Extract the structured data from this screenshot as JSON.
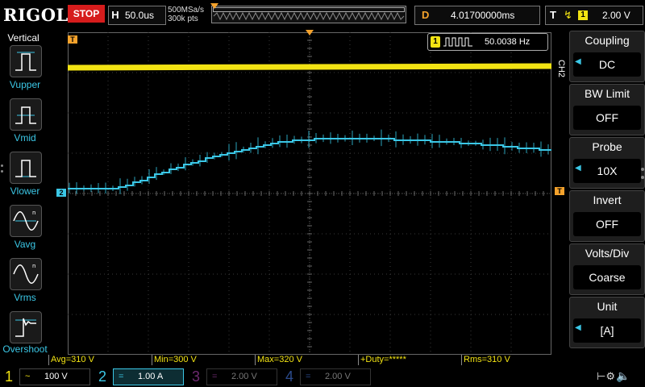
{
  "topbar": {
    "brand": "RIGOL",
    "run_status": "STOP",
    "timebase_label": "H",
    "timebase_value": "50.0us",
    "sample_rate": "500MSa/s",
    "memory_depth": "300k pts",
    "delay_label": "D",
    "delay_value": "4.01700000ms",
    "trigger_label": "T",
    "trigger_source": "1",
    "trigger_level": "2.00 V"
  },
  "left_menu": {
    "title": "Vertical",
    "items": [
      {
        "label": "Vupper",
        "icon": "vupper-icon"
      },
      {
        "label": "Vmid",
        "icon": "vmid-icon"
      },
      {
        "label": "Vlower",
        "icon": "vlower-icon"
      },
      {
        "label": "Vavg",
        "icon": "vavg-icon"
      },
      {
        "label": "Vrms",
        "icon": "vrms-icon"
      },
      {
        "label": "Overshoot",
        "icon": "overshoot-icon"
      }
    ]
  },
  "right_menu": {
    "channel_tab": "CH2",
    "items": [
      {
        "title": "Coupling",
        "value": "DC",
        "has_arrow": true
      },
      {
        "title": "BW Limit",
        "value": "OFF",
        "has_arrow": false
      },
      {
        "title": "Probe",
        "value": "10X",
        "has_arrow": true
      },
      {
        "title": "Invert",
        "value": "OFF",
        "has_arrow": false
      },
      {
        "title": "Volts/Div",
        "value": "Coarse",
        "has_arrow": false
      },
      {
        "title": "Unit",
        "value": "[A]",
        "has_arrow": true
      }
    ]
  },
  "frequency_counter": {
    "channel": "1",
    "value": "50.0038 Hz"
  },
  "markers": {
    "trigger_position": "T",
    "ch2_offset": "2",
    "trigger_level": "T"
  },
  "measurements": [
    {
      "label": "Avg=310 V"
    },
    {
      "label": "Min=300 V"
    },
    {
      "label": "Max=320 V"
    },
    {
      "label": "+Duty=*****"
    },
    {
      "label": "Rms=310 V"
    }
  ],
  "channels": [
    {
      "number": "1",
      "coupling": "~",
      "scale": "100 V",
      "color": "#f2e313",
      "active": true
    },
    {
      "number": "2",
      "coupling": "=",
      "scale": "1.00 A",
      "color": "#3bc7e6",
      "active": true,
      "selected": true
    },
    {
      "number": "3",
      "coupling": "=",
      "scale": "2.00 V",
      "color": "#c24bc4",
      "active": false
    },
    {
      "number": "4",
      "coupling": "=",
      "scale": "2.00 V",
      "color": "#3b6fe0",
      "active": false
    }
  ],
  "waveforms": {
    "ch1_level_fraction": 0.11,
    "ch2_start_fraction": 0.485,
    "ch2_peak_fraction": 0.33
  },
  "colors": {
    "ch1": "#f2e313",
    "ch2": "#3bc7e6",
    "ch3": "#c24bc4",
    "ch4": "#3b6fe0",
    "trigger_marker": "#f4a22c",
    "stop": "#d61c1c",
    "grid": "#444444"
  }
}
